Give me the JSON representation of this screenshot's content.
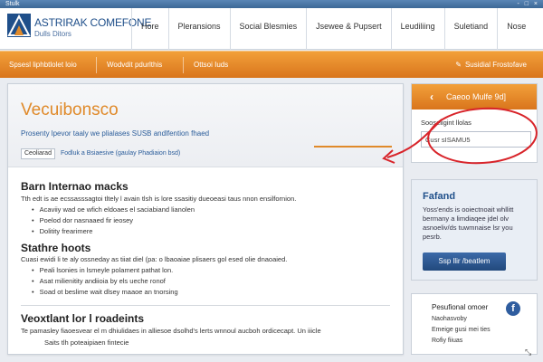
{
  "browser": {
    "tab": "Stulk",
    "controls": "- □ ×"
  },
  "header": {
    "logo_title": "ASTRIRAK COMEFONE",
    "logo_sub": "Dulls Ditors",
    "nav": [
      "Hore",
      "Pleransions",
      "Social Blesmies",
      "Jsewee & Pupsert",
      "Leudiliing",
      "Suletiand",
      "Nose"
    ]
  },
  "subnav": {
    "items": [
      "Spsesl liphbtlolet loio",
      "Wodvdit pdurlthis",
      "Ottsoi Iuds"
    ],
    "right": "Susidial Frostofave"
  },
  "hero": {
    "title": "Vecuibonsco",
    "tagline": "Prosenty lpevor taaly we plialases SUSB andlfention fhaed",
    "badge": "Ceoliarad",
    "meta_link": "Fodluk a Bsiaesive (gaulay Phadiaion bsd)"
  },
  "content": {
    "section1_title": "Barn Internao macks",
    "section1_para": "Tth edt is ae ecssasssagtoi tltely l avain tlsh is lore ssasitiy dueoeasi taus nnon ensilfornion.",
    "section1_bullets": [
      "Acaviiy wad oe wfich eldoaes el saciabiand lianolen",
      "Poelod dor nasnaaed fir ieosey",
      "Dolitity frearimere"
    ],
    "section2_title": "Stathre hoots",
    "section2_para": "Cuasi ewidi li te aly ossneday as tiiat diel (pa: o lbaoaiae plisaers gol esed olie dnaoaied.",
    "section2_bullets": [
      "Peali lsonies in lsmeyle polament pathat lon.",
      "Asat milienitity andiioia by els ueche ronof",
      "Soad ot beslime wait dlsey maaoe an tnorsing"
    ],
    "section3_title": "Veoxtlant lor l roadeints",
    "section3_para": "Te pamasley fiaoesvear el m dhiulidaes in alliesoe dsolhd's lerts wnnoul aucboh ordicecapt. Un iiicle",
    "section3_sub": "Saits tlh poteaipiaen fintecie"
  },
  "sidebar": {
    "search_head": "Caeoo Mulfe 9d]",
    "search_label": "Sooseligint llolas",
    "search_value": "Cusr sISAMU5",
    "feature_title": "Fafand",
    "feature_text": "Yoss'ends is ooiectnoait whllitt bermany a limdiaqee jdel olv asnoeliv/ds tuwmnaise lsr you pesrb.",
    "feature_button": "Ssp llir /beatlem",
    "social_title": "Pesufional omoer",
    "social_lines": [
      "Naohasvoby",
      "Emeige gusi mei ties",
      "Rofiy fiiuas"
    ],
    "facebook_glyph": "f"
  },
  "colors": {
    "accent": "#e08a2a",
    "brand": "#1f4f8a",
    "annotation": "#d8242a"
  }
}
